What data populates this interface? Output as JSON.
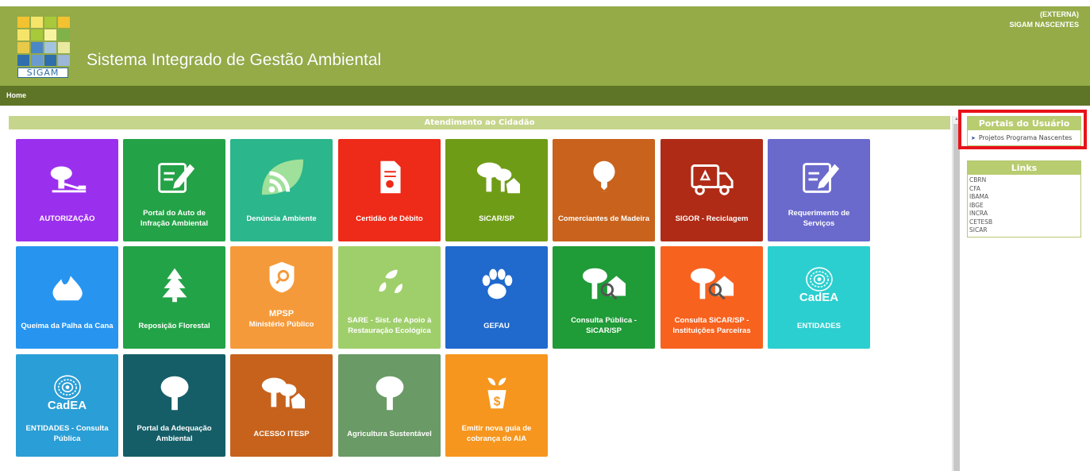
{
  "header": {
    "logo_text": "SIGAM",
    "title": "Sistema Integrado de Gestão Ambiental",
    "user_line1": "(EXTERNA)",
    "user_line2": "SIGAM NASCENTES"
  },
  "nav": {
    "home": "Home"
  },
  "main": {
    "section_title": "Atendimento ao Cidadão",
    "tiles": [
      {
        "label": "AUTORIZAÇÃO",
        "color": "#9b2fee",
        "icon": "tree-stump-icon"
      },
      {
        "label": "Portal do Auto de Infração Ambiental",
        "color": "#24a247",
        "icon": "edit-document-icon"
      },
      {
        "label": "Denúncia Ambiente",
        "color": "#2bb68c",
        "icon": "leaf-signal-icon"
      },
      {
        "label": "Certidão de Débito",
        "color": "#ee2a18",
        "icon": "certificate-icon"
      },
      {
        "label": "SiCAR/SP",
        "color": "#6f9c17",
        "icon": "trees-house-icon"
      },
      {
        "label": "Comerciantes de Madeira",
        "color": "#c8621c",
        "icon": "cut-tree-icon"
      },
      {
        "label": "SIGOR - Reciclagem",
        "color": "#b02b16",
        "icon": "recycling-truck-icon"
      },
      {
        "label": "Requerimento de Serviços",
        "color": "#6a6acd",
        "icon": "edit-document-icon"
      },
      {
        "label": "Queima da Palha da Cana",
        "color": "#2795f0",
        "icon": "fire-icon"
      },
      {
        "label": "Reposição Florestal",
        "color": "#23a347",
        "icon": "pine-tree-icon"
      },
      {
        "label": "MPSP Ministério Público",
        "color": "#f59a3a",
        "icon": "shield-search-icon",
        "sub": "MPSP",
        "sub2": "Ministério Público"
      },
      {
        "label": "SARE - Sist. de Apoio à Restauração Ecológica",
        "color": "#9fcf6b",
        "icon": "leaves-icon"
      },
      {
        "label": "GEFAU",
        "color": "#2069cd",
        "icon": "paw-icon"
      },
      {
        "label": "Consulta Pública - SiCAR/SP",
        "color": "#1f9b37",
        "icon": "trees-search-icon"
      },
      {
        "label": "Consulta SiCAR/SP - Instituições Parceiras",
        "color": "#f7621f",
        "icon": "trees-search-icon"
      },
      {
        "label": "ENTIDADES",
        "color": "#2ccfcf",
        "icon": "cadea-logo-icon",
        "badge": "CadEA"
      },
      {
        "label": "ENTIDADES - Consulta Pública",
        "color": "#2a9ed6",
        "icon": "cadea-logo-icon",
        "badge": "CadEA"
      },
      {
        "label": "Portal da Adequação Ambiental",
        "color": "#155e68",
        "icon": "tree-icon"
      },
      {
        "label": "ACESSO ITESP",
        "color": "#c6621c",
        "icon": "trees-house-icon"
      },
      {
        "label": "Agricultura Sustentável",
        "color": "#6a9a65",
        "icon": "tree-icon"
      },
      {
        "label": "Emitir nova guia de cobrança do AIA",
        "color": "#f6961e",
        "icon": "money-plant-icon"
      }
    ]
  },
  "sidebar": {
    "portals_title": "Portais do Usuário",
    "portal_items": [
      "Projetos Programa Nascentes"
    ],
    "links_title": "Links",
    "links": [
      "CBRN",
      "CFA",
      "IBAMA",
      "IBGE",
      "INCRA",
      "CETESB",
      "SICAR"
    ]
  }
}
